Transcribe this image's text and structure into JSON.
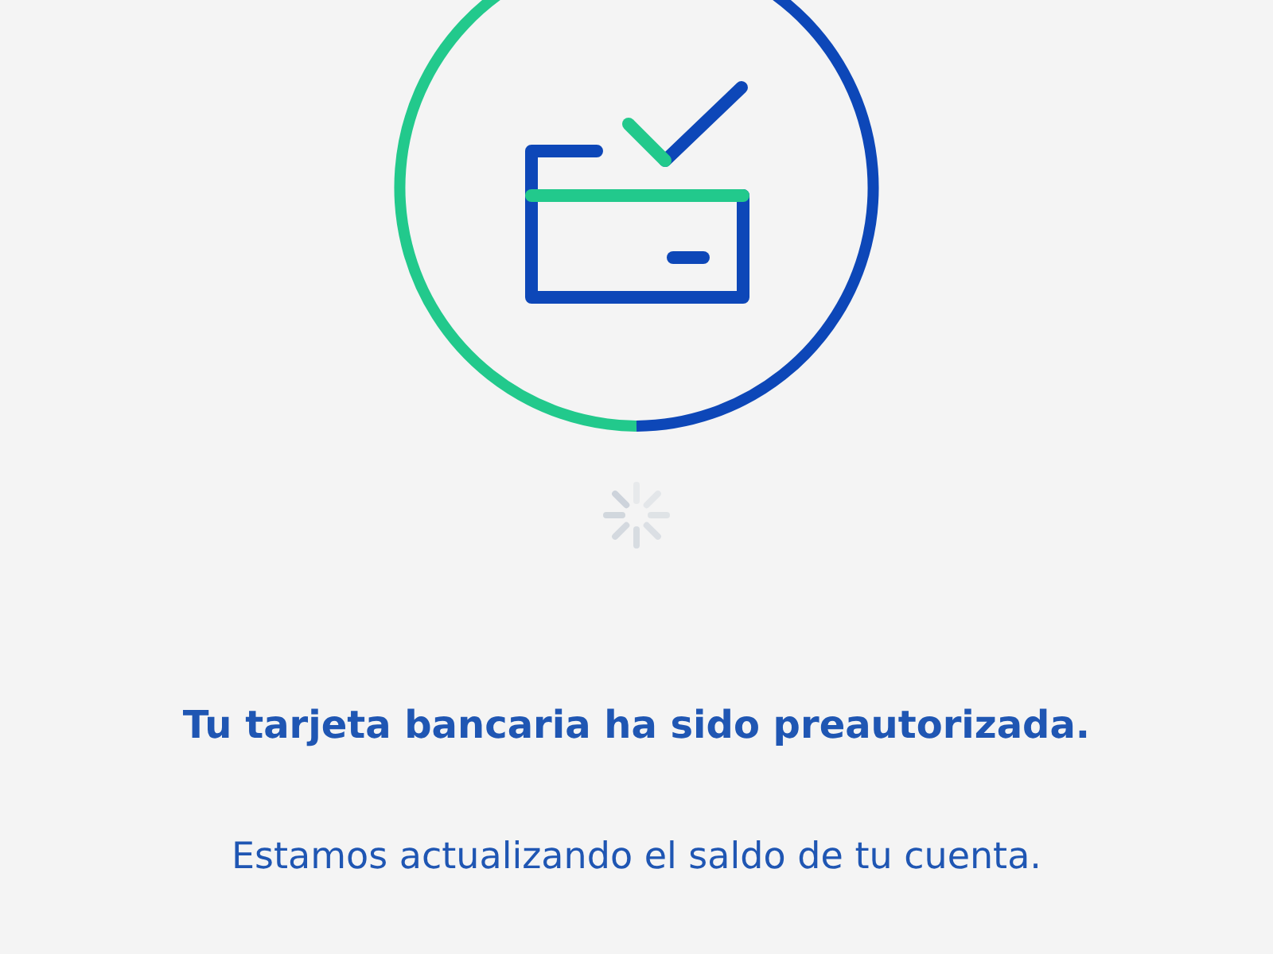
{
  "title": "Tu tarjeta bancaria ha sido preautorizada.",
  "message": "Estamos actualizando el saldo de tu cuenta."
}
